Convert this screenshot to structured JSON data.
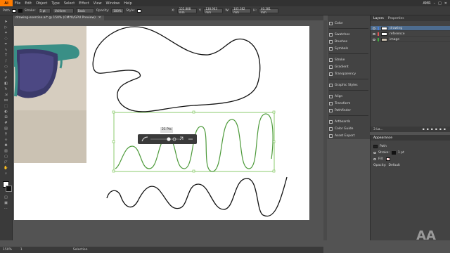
{
  "app": {
    "logo": "Ai"
  },
  "menu": [
    "File",
    "Edit",
    "Object",
    "Type",
    "Select",
    "Effect",
    "View",
    "Window",
    "Help"
  ],
  "workspace": {
    "name": "AMR"
  },
  "control_bar": {
    "selection": "Path",
    "stroke_label": "Stroke:",
    "stroke_value": "1 pt",
    "profile_label": "Uniform",
    "brush_label": "Basic",
    "opacity_label": "Opacity:",
    "opacity_value": "100%",
    "style_label": "Style:",
    "x_value": "155.888 mm",
    "y_value": "138.903 mm",
    "w_value": "105.382 mm",
    "h_value": "40.381 mm"
  },
  "document_tab": {
    "title": "drawing-exercise.ai* @ 150% (CMYK/GPU Preview)"
  },
  "widget": {
    "size_tip": "21 Pts"
  },
  "panel_column": {
    "items": [
      "Color",
      "Swatches",
      "Brushes",
      "Symbols",
      "Stroke",
      "Gradient",
      "Transparency",
      "Graphic Styles",
      "Align",
      "Transform",
      "Pathfinder",
      "Artboards",
      "Color Guide",
      "Asset Export"
    ]
  },
  "layers_panel": {
    "tabs": [
      "Layers",
      "Properties"
    ],
    "layers": [
      {
        "name": "drawing",
        "color": "#4a7fd4",
        "selected": true
      },
      {
        "name": "reference",
        "color": "#e05656",
        "selected": false
      },
      {
        "name": "image",
        "color": "#3fae3f",
        "selected": false
      }
    ],
    "footer_count": "3 La..."
  },
  "appearance_panel": {
    "tab": "Appearance",
    "header": "Path",
    "stroke_label": "Stroke:",
    "stroke_value": "1 pt",
    "fill_label": "Fill:",
    "opacity_label": "Opacity:",
    "opacity_value": "Default"
  },
  "status_bar": {
    "zoom": "150%",
    "artboard": "1",
    "tool": "Selection"
  },
  "watermark": {
    "text": "AA"
  },
  "colors": {
    "accent": "#ff7c00",
    "selection": "#6fbf4a",
    "canvas": "#535353"
  }
}
